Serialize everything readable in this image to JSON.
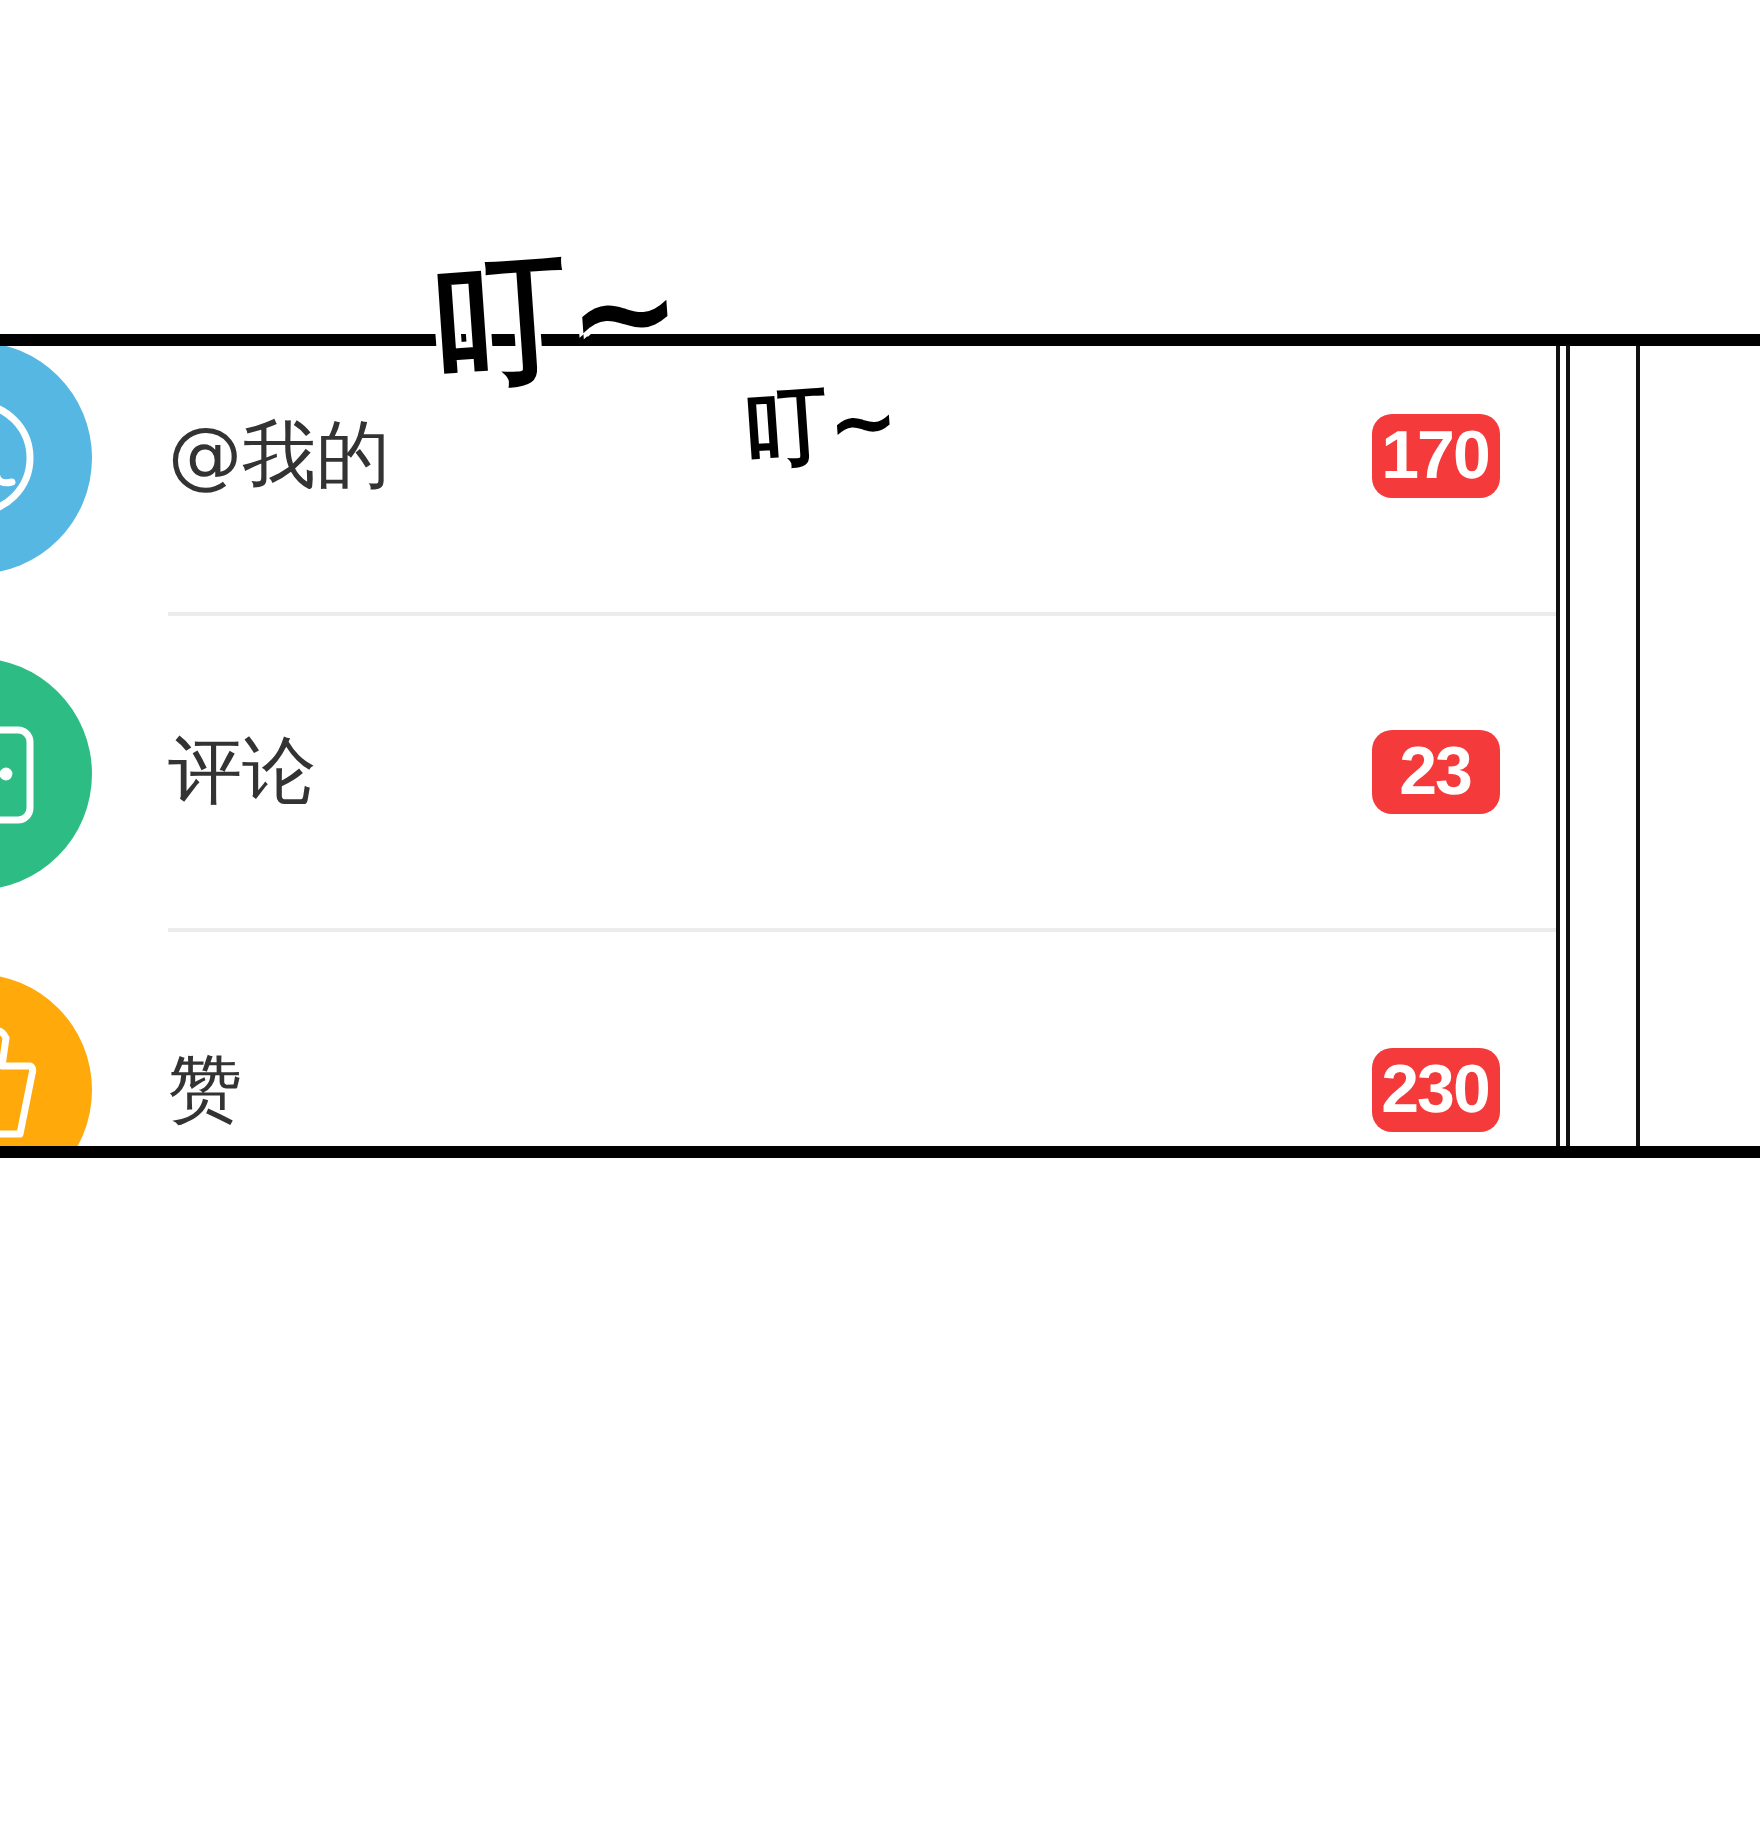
{
  "panel": {
    "items": [
      {
        "kind": "mention",
        "color": "#55b7e2",
        "label": "@我的",
        "count": "170"
      },
      {
        "kind": "comment",
        "color": "#2dbd84",
        "label": "评论",
        "count": "23"
      },
      {
        "kind": "like",
        "color": "#ffa90a",
        "label": "赞",
        "count": "230"
      }
    ]
  },
  "sound_effects": [
    {
      "text": "叮~"
    },
    {
      "text": "叮~"
    }
  ]
}
